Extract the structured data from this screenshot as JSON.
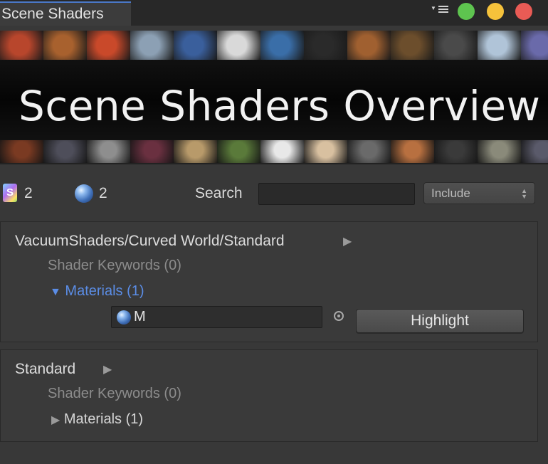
{
  "window": {
    "tab_title": "Scene Shaders",
    "controls": [
      "green",
      "yellow",
      "red"
    ],
    "control_colors": {
      "green": "#5ec44f",
      "yellow": "#f5c23b",
      "red": "#e95b55"
    }
  },
  "banner": {
    "title": "Scene Shaders Overview"
  },
  "stats": {
    "shader_count": "2",
    "material_count": "2",
    "shader_icon_glyph": "S"
  },
  "search": {
    "label": "Search",
    "value": "",
    "filter_selected": "Include"
  },
  "shaders": [
    {
      "name": "VacuumShaders/Curved World/Standard",
      "keywords_label": "Shader Keywords (0)",
      "materials_label": "Materials (1)",
      "expanded": true,
      "materials": [
        {
          "name": "M",
          "action_label": "Highlight"
        }
      ]
    },
    {
      "name": "Standard",
      "keywords_label": "Shader Keywords (0)",
      "materials_label": "Materials (1)",
      "expanded": false
    }
  ],
  "icons": {
    "menu": "menu-icon",
    "shader": "shader-icon",
    "material": "material-sphere-icon",
    "picker": "object-picker-icon",
    "play": "play-triangle-icon"
  },
  "colors": {
    "accent_blue": "#5b8de6",
    "tab_accent": "#4a78c8",
    "panel_bg": "#383838"
  }
}
